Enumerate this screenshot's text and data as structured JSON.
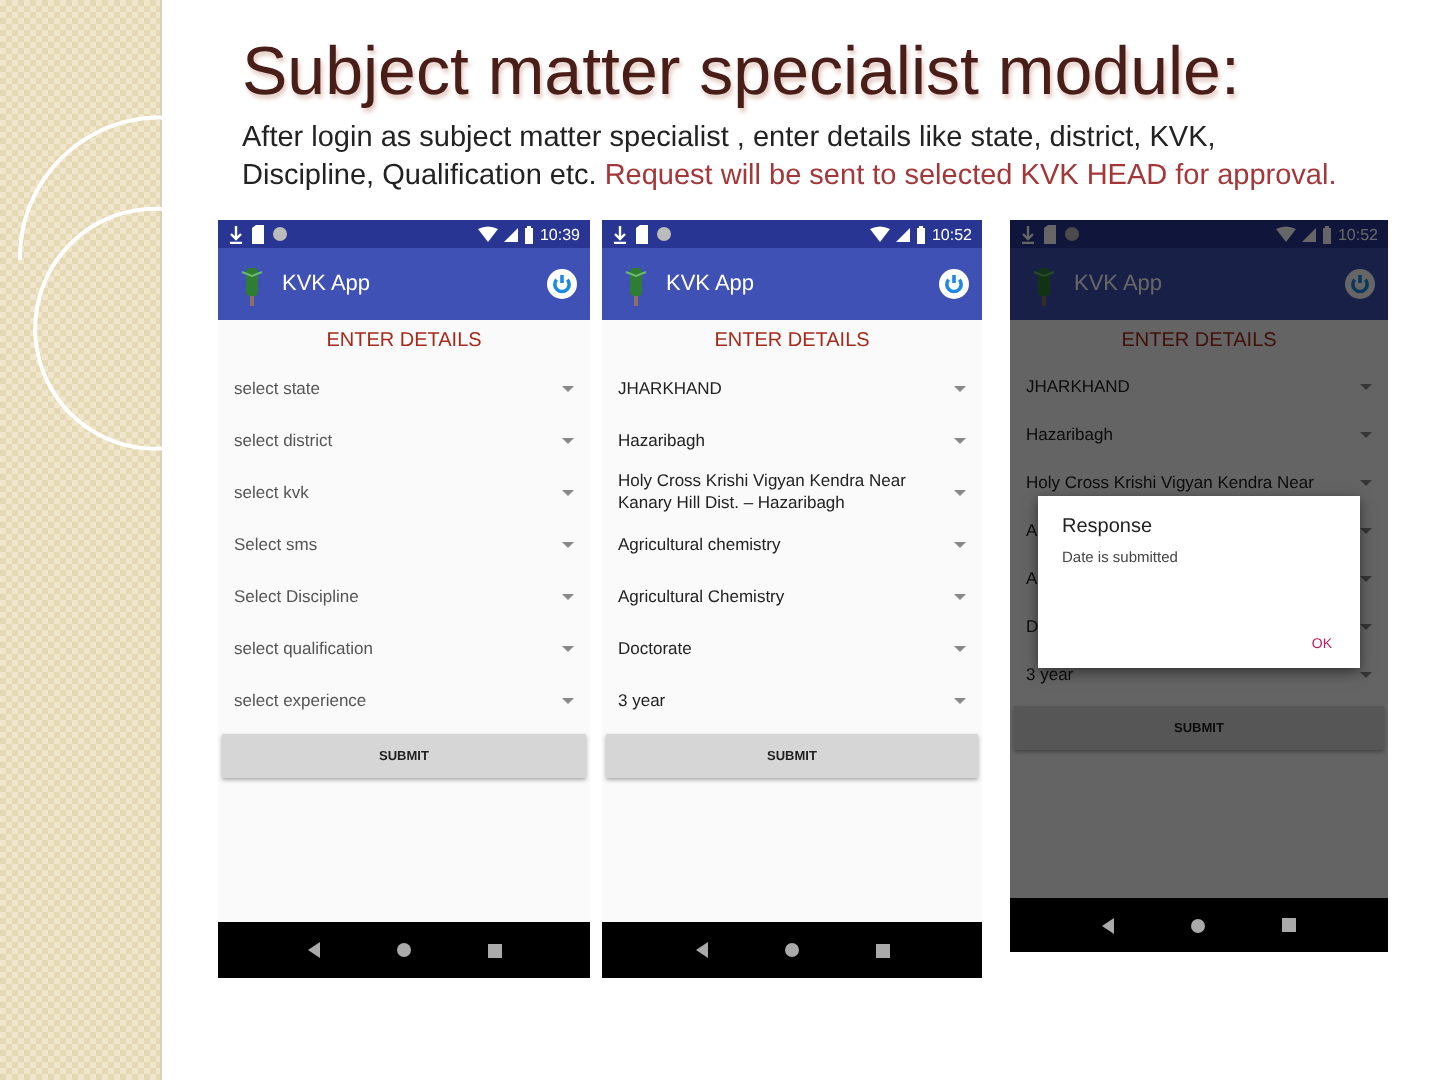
{
  "slide": {
    "title": "Subject matter specialist module:",
    "body": [
      {
        "text": "After login as subject matter specialist , enter details like state, district, KVK, Discipline, Qualification etc. ",
        "highlight": false
      },
      {
        "text": " Request will be sent to selected KVK HEAD for approval.",
        "highlight": true
      }
    ]
  },
  "phones": [
    {
      "time": "10:39",
      "app_title": "KVK App",
      "heading": "ENTER DETAILS",
      "dimmed": false,
      "submit": "SUBMIT",
      "fields": [
        {
          "text": "select state",
          "hint": true
        },
        {
          "text": "select district",
          "hint": true
        },
        {
          "text": "select kvk",
          "hint": true
        },
        {
          "text": "Select sms",
          "hint": true
        },
        {
          "text": "Select Discipline",
          "hint": true
        },
        {
          "text": "select qualification",
          "hint": true
        },
        {
          "text": "select experience",
          "hint": true
        }
      ]
    },
    {
      "time": "10:52",
      "app_title": "KVK App",
      "heading": "ENTER DETAILS",
      "dimmed": false,
      "submit": "SUBMIT",
      "fields": [
        {
          "text": "JHARKHAND",
          "hint": false
        },
        {
          "text": "Hazaribagh",
          "hint": false
        },
        {
          "text": "Holy Cross Krishi Vigyan Kendra Near Kanary Hill Dist. – Hazaribagh",
          "hint": false
        },
        {
          "text": "Agricultural chemistry",
          "hint": false
        },
        {
          "text": "Agricultural Chemistry",
          "hint": false
        },
        {
          "text": "Doctorate",
          "hint": false
        },
        {
          "text": "3 year",
          "hint": false
        }
      ]
    },
    {
      "time": "10:52",
      "app_title": "KVK App",
      "heading": "ENTER DETAILS",
      "dimmed": true,
      "submit": "SUBMIT",
      "fields": [
        {
          "text": "JHARKHAND",
          "hint": false
        },
        {
          "text": "Hazaribagh",
          "hint": false
        },
        {
          "text": "Holy Cross Krishi Vigyan Kendra Near",
          "hint": false
        },
        {
          "text": "A",
          "hint": false
        },
        {
          "text": "A",
          "hint": false
        },
        {
          "text": "D",
          "hint": false
        },
        {
          "text": "3 year",
          "hint": false
        }
      ],
      "dialog": {
        "title": "Response",
        "message": "Date is submitted",
        "button": "OK"
      }
    }
  ]
}
